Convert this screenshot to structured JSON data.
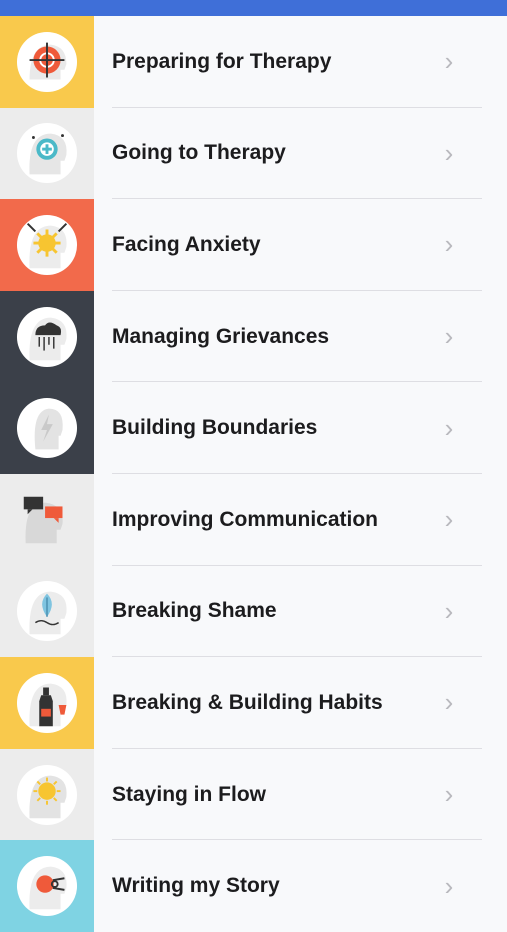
{
  "topics": [
    {
      "label": "Preparing for Therapy",
      "icon": "target-head-icon",
      "bg": "#f9c94c"
    },
    {
      "label": "Going to Therapy",
      "icon": "medical-cross-head-icon",
      "bg": "#ececec"
    },
    {
      "label": "Facing Anxiety",
      "icon": "burst-head-icon",
      "bg": "#f26a4b"
    },
    {
      "label": "Managing Grievances",
      "icon": "storm-cloud-head-icon",
      "bg": "#3b4049"
    },
    {
      "label": "Building Boundaries",
      "icon": "bolt-head-icon",
      "bg": "#3b4049"
    },
    {
      "label": "Improving Communication",
      "icon": "chat-bubbles-head-icon",
      "bg": "#ececec"
    },
    {
      "label": "Breaking Shame",
      "icon": "leaf-head-icon",
      "bg": "#ececec"
    },
    {
      "label": "Breaking & Building Habits",
      "icon": "bottle-head-icon",
      "bg": "#f9c94c"
    },
    {
      "label": "Staying in Flow",
      "icon": "sun-head-icon",
      "bg": "#ececec"
    },
    {
      "label": "Writing my Story",
      "icon": "pen-head-icon",
      "bg": "#7fd3e3"
    }
  ],
  "chevron": "›",
  "colors": {
    "topbar": "#3f6fd8",
    "separator": "#dedee3",
    "chevron": "#b9b9be"
  }
}
